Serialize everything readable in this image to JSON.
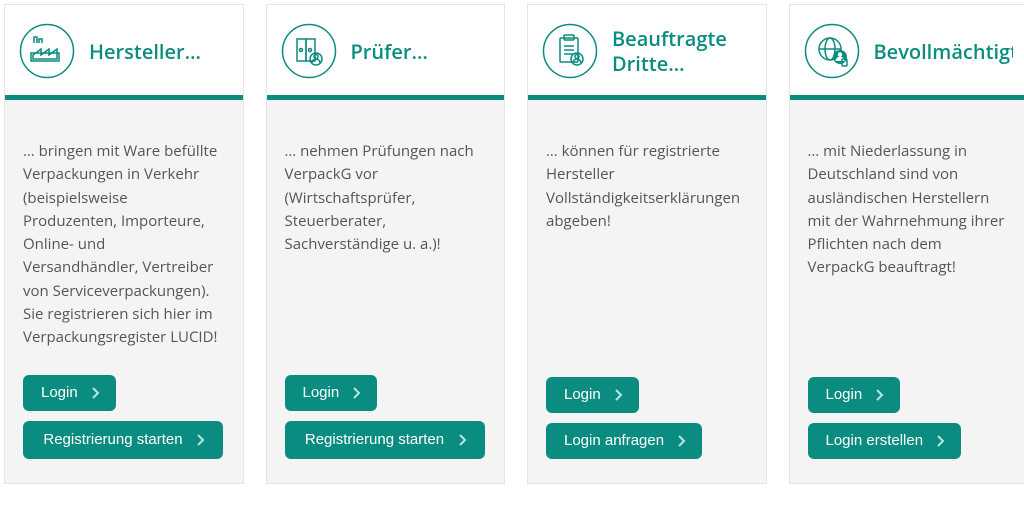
{
  "colors": {
    "accent": "#0a8c80"
  },
  "cards": [
    {
      "title": "Hersteller…",
      "icon": "factory-icon",
      "description": "… bringen mit Ware befüllte Verpackungen in Verkehr (beispielsweise Produzenten, Importeure, Online- und Versandhändler, Vertreiber von Serviceverpackungen). Sie registrieren sich hier im Verpackungsregister LUCID!",
      "login": "Login",
      "secondary": "Registrierung starten"
    },
    {
      "title": "Prüfer…",
      "icon": "binders-icon",
      "description": "… nehmen Prüfungen nach VerpackG vor (Wirtschaftsprüfer, Steuerberater, Sachverständige u. a.)!",
      "login": "Login",
      "secondary": "Registrierung starten"
    },
    {
      "title": "Beauftragte Dritte…",
      "icon": "clipboard-user-icon",
      "description": "… können für registrierte Hersteller Vollständigkeitserklärungen abgeben!",
      "login": "Login",
      "secondary": "Login anfragen"
    },
    {
      "title": "Bevollmächtigte…",
      "icon": "globe-user-icon",
      "description": "… mit Niederlassung in Deutschland sind von ausländischen Herstellern mit der Wahrnehmung ihrer Pflichten nach dem VerpackG beauftragt!",
      "login": "Login",
      "secondary": "Login erstellen"
    }
  ]
}
